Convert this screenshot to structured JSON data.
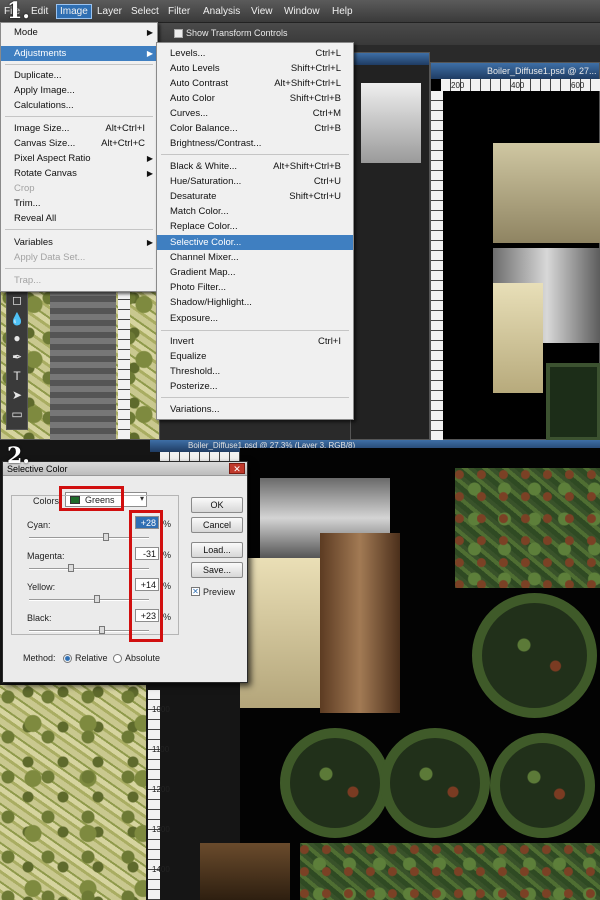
{
  "step1": "1.",
  "step2": "2.",
  "menubar": [
    "File",
    "Edit",
    "Image",
    "Layer",
    "Select",
    "Filter",
    "Analysis",
    "View",
    "Window",
    "Help"
  ],
  "options": {
    "transform_controls": "Show Transform Controls"
  },
  "documents": {
    "right_title": "Boiler_Diffuse1.psd @ 27...",
    "bottom_title": "Boiler_Diffuse1.psd @ 27.3% (Layer 3, RGB/8)"
  },
  "rulers": {
    "top_right": [
      "200",
      "400",
      "600"
    ],
    "bottom": [
      "200",
      "1200",
      "1400",
      "1600",
      "1800"
    ],
    "left_doc": [
      "1000",
      "1100",
      "1200",
      "1300",
      "1400"
    ]
  },
  "image_menu": {
    "items": [
      {
        "label": "Mode",
        "shortcut": "",
        "disabled": false,
        "arrow": true
      },
      {
        "label": "Adjustments",
        "shortcut": "",
        "disabled": false,
        "arrow": true,
        "highlight": true
      },
      {
        "label": "Duplicate...",
        "shortcut": "",
        "disabled": false
      },
      {
        "label": "Apply Image...",
        "shortcut": "",
        "disabled": false
      },
      {
        "label": "Calculations...",
        "shortcut": "",
        "disabled": false
      },
      {
        "label": "Image Size...",
        "shortcut": "Alt+Ctrl+I",
        "disabled": false
      },
      {
        "label": "Canvas Size...",
        "shortcut": "Alt+Ctrl+C",
        "disabled": false
      },
      {
        "label": "Pixel Aspect Ratio",
        "shortcut": "",
        "disabled": false,
        "arrow": true
      },
      {
        "label": "Rotate Canvas",
        "shortcut": "",
        "disabled": false,
        "arrow": true
      },
      {
        "label": "Crop",
        "shortcut": "",
        "disabled": true
      },
      {
        "label": "Trim...",
        "shortcut": "",
        "disabled": false
      },
      {
        "label": "Reveal All",
        "shortcut": "",
        "disabled": false
      },
      {
        "label": "Variables",
        "shortcut": "",
        "disabled": false,
        "arrow": true
      },
      {
        "label": "Apply Data Set...",
        "shortcut": "",
        "disabled": true
      },
      {
        "label": "Trap...",
        "shortcut": "",
        "disabled": true
      }
    ]
  },
  "adjust_menu": {
    "items": [
      {
        "label": "Levels...",
        "shortcut": "Ctrl+L"
      },
      {
        "label": "Auto Levels",
        "shortcut": "Shift+Ctrl+L"
      },
      {
        "label": "Auto Contrast",
        "shortcut": "Alt+Shift+Ctrl+L"
      },
      {
        "label": "Auto Color",
        "shortcut": "Shift+Ctrl+B"
      },
      {
        "label": "Curves...",
        "shortcut": "Ctrl+M"
      },
      {
        "label": "Color Balance...",
        "shortcut": "Ctrl+B"
      },
      {
        "label": "Brightness/Contrast...",
        "shortcut": ""
      },
      {
        "label": "Black & White...",
        "shortcut": "Alt+Shift+Ctrl+B"
      },
      {
        "label": "Hue/Saturation...",
        "shortcut": "Ctrl+U"
      },
      {
        "label": "Desaturate",
        "shortcut": "Shift+Ctrl+U"
      },
      {
        "label": "Match Color...",
        "shortcut": ""
      },
      {
        "label": "Replace Color...",
        "shortcut": ""
      },
      {
        "label": "Selective Color...",
        "shortcut": "",
        "highlight": true
      },
      {
        "label": "Channel Mixer...",
        "shortcut": ""
      },
      {
        "label": "Gradient Map...",
        "shortcut": ""
      },
      {
        "label": "Photo Filter...",
        "shortcut": ""
      },
      {
        "label": "Shadow/Highlight...",
        "shortcut": ""
      },
      {
        "label": "Exposure...",
        "shortcut": ""
      },
      {
        "label": "Invert",
        "shortcut": "Ctrl+I"
      },
      {
        "label": "Equalize",
        "shortcut": ""
      },
      {
        "label": "Threshold...",
        "shortcut": ""
      },
      {
        "label": "Posterize...",
        "shortcut": ""
      },
      {
        "label": "Variations...",
        "shortcut": ""
      }
    ]
  },
  "dialog": {
    "title": "Selective Color",
    "colors_label": "Colors:",
    "colors_value": "Greens",
    "colors_swatch": "#1f6b2a",
    "sliders": [
      {
        "label": "Cyan:",
        "value": "+28",
        "level": 0.64
      },
      {
        "label": "Magenta:",
        "value": "-31",
        "level": 0.35
      },
      {
        "label": "Yellow:",
        "value": "+14",
        "level": 0.57
      },
      {
        "label": "Black:",
        "value": "+23",
        "level": 0.61
      }
    ],
    "unit": "%",
    "buttons": {
      "ok": "OK",
      "cancel": "Cancel",
      "load": "Load...",
      "save": "Save..."
    },
    "preview": "Preview",
    "method_label": "Method:",
    "method_options": [
      "Relative",
      "Absolute"
    ],
    "highlight_color": "#d10f0f"
  }
}
